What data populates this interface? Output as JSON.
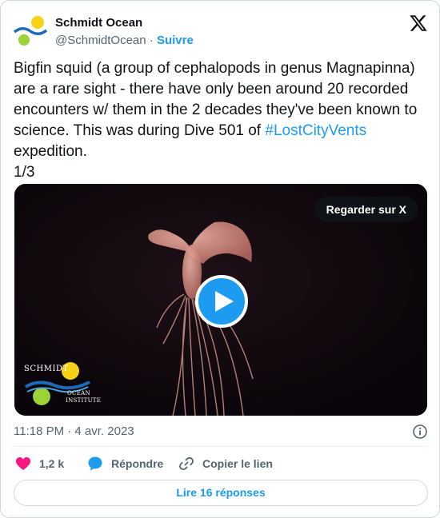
{
  "author": {
    "name": "Schmidt Ocean",
    "handle": "@SchmidtOcean",
    "separator": " · ",
    "follow_label": "Suivre"
  },
  "tweet": {
    "text_before": "Bigfin squid (a group of cephalopods in genus Magnapinna) are a rare sight - there have only been around 20 recorded encounters w/ them in the 2 decades they've been known to science. This was during Dive 501 of ",
    "hashtag": "#LostCityVents",
    "text_after": " expedition.",
    "thread_count": "1/3"
  },
  "media": {
    "watch_label": "Regarder sur X",
    "watermark_top": "SCHMIDT",
    "watermark_line1": "OCEAN",
    "watermark_line2": "INSTITUTE"
  },
  "meta": {
    "timestamp": "11:18 PM · 4 avr. 2023"
  },
  "actions": {
    "like_count": "1,2 k",
    "reply_label": "Répondre",
    "copy_label": "Copier le lien"
  },
  "replies_button": "Lire 16 réponses",
  "colors": {
    "accent": "#1d9bf0",
    "like": "#f91880",
    "text": "#0f1419",
    "muted": "#536471",
    "logo_yellow": "#f7d117",
    "logo_green": "#9ad436",
    "logo_blue": "#1d6bb8"
  },
  "icons": {
    "avatar": "schmidt-ocean-logo",
    "brand": "x-logo-icon",
    "info": "info-icon",
    "like": "heart-icon",
    "reply": "speech-bubble-icon",
    "copy": "link-icon",
    "play": "play-icon"
  }
}
